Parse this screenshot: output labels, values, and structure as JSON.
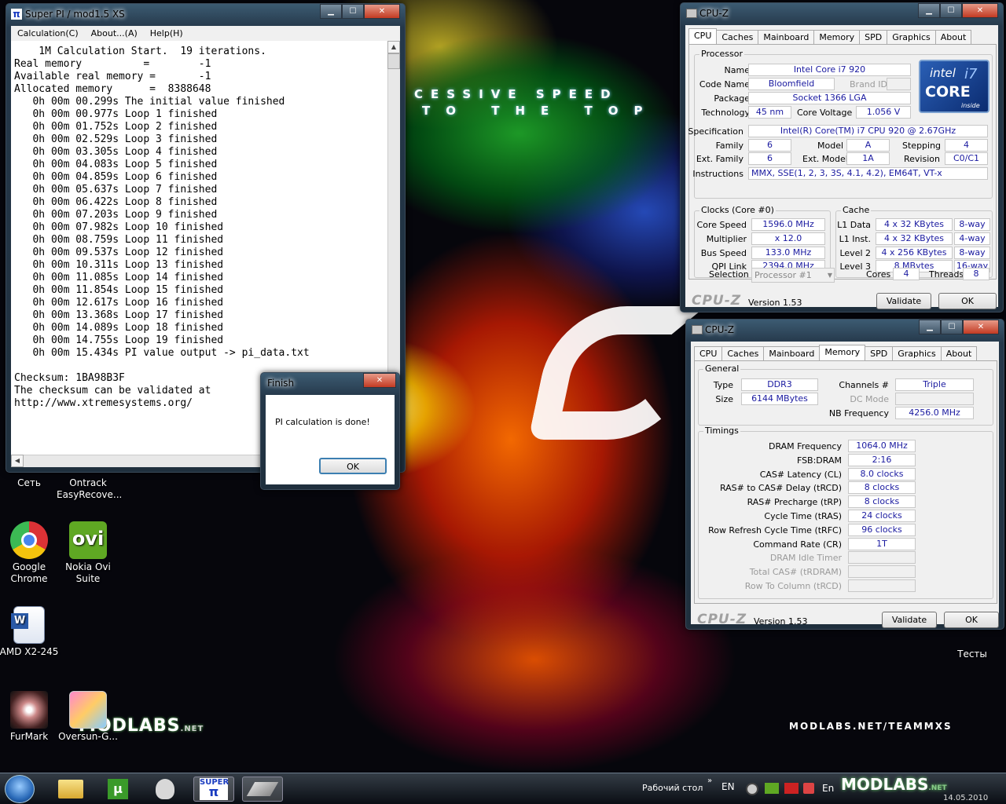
{
  "superpi": {
    "title": "Super PI / mod1.5 XS",
    "menu": [
      "Calculation(C)",
      "About...(A)",
      "Help(H)"
    ],
    "lines": [
      "    1M Calculation Start.  19 iterations.",
      "Real memory          =        -1",
      "Available real memory =       -1",
      "Allocated memory      =  8388648",
      "   0h 00m 00.299s The initial value finished",
      "   0h 00m 00.977s Loop 1 finished",
      "   0h 00m 01.752s Loop 2 finished",
      "   0h 00m 02.529s Loop 3 finished",
      "   0h 00m 03.305s Loop 4 finished",
      "   0h 00m 04.083s Loop 5 finished",
      "   0h 00m 04.859s Loop 6 finished",
      "   0h 00m 05.637s Loop 7 finished",
      "   0h 00m 06.422s Loop 8 finished",
      "   0h 00m 07.203s Loop 9 finished",
      "   0h 00m 07.982s Loop 10 finished",
      "   0h 00m 08.759s Loop 11 finished",
      "   0h 00m 09.537s Loop 12 finished",
      "   0h 00m 10.311s Loop 13 finished",
      "   0h 00m 11.085s Loop 14 finished",
      "   0h 00m 11.854s Loop 15 finished",
      "   0h 00m 12.617s Loop 16 finished",
      "   0h 00m 13.368s Loop 17 finished",
      "   0h 00m 14.089s Loop 18 finished",
      "   0h 00m 14.755s Loop 19 finished",
      "   0h 00m 15.434s PI value output -> pi_data.txt",
      "",
      "Checksum: 1BA98B3F",
      "The checksum can be validated at",
      "http://www.xtremesystems.org/"
    ]
  },
  "finish": {
    "title": "Finish",
    "message": "PI calculation is done!",
    "ok": "OK"
  },
  "cpuz1": {
    "title": "CPU-Z",
    "tabs": [
      "CPU",
      "Caches",
      "Mainboard",
      "Memory",
      "SPD",
      "Graphics",
      "About"
    ],
    "processor_title": "Processor",
    "name_l": "Name",
    "name": "Intel Core i7 920",
    "codename_l": "Code Name",
    "codename": "Bloomfield",
    "brandid_l": "Brand ID",
    "package_l": "Package",
    "package": "Socket 1366 LGA",
    "technology_l": "Technology",
    "technology": "45 nm",
    "voltage_l": "Core Voltage",
    "voltage": "1.056 V",
    "spec_l": "Specification",
    "spec": "Intel(R) Core(TM) i7 CPU        920  @ 2.67GHz",
    "family_l": "Family",
    "family": "6",
    "model_l": "Model",
    "model": "A",
    "stepping_l": "Stepping",
    "stepping": "4",
    "extfamily_l": "Ext. Family",
    "extfamily": "6",
    "extmodel_l": "Ext. Model",
    "extmodel": "1A",
    "revision_l": "Revision",
    "revision": "C0/C1",
    "instr_l": "Instructions",
    "instr": "MMX, SSE(1, 2, 3, 3S, 4.1, 4.2), EM64T, VT-x",
    "clocks_title": "Clocks (Core #0)",
    "corespeed_l": "Core Speed",
    "corespeed": "1596.0 MHz",
    "multiplier_l": "Multiplier",
    "multiplier": "x 12.0",
    "busspeed_l": "Bus Speed",
    "busspeed": "133.0 MHz",
    "qpi_l": "QPI Link",
    "qpi": "2394.0 MHz",
    "cache_title": "Cache",
    "l1d_l": "L1 Data",
    "l1d": "4 x 32 KBytes",
    "l1d_w": "8-way",
    "l1i_l": "L1 Inst.",
    "l1i": "4 x 32 KBytes",
    "l1i_w": "4-way",
    "l2_l": "Level 2",
    "l2": "4 x 256 KBytes",
    "l2_w": "8-way",
    "l3_l": "Level 3",
    "l3": "8 MBytes",
    "l3_w": "16-way",
    "selection_l": "Selection",
    "selection": "Processor #1",
    "cores_l": "Cores",
    "cores": "4",
    "threads_l": "Threads",
    "threads": "8",
    "brand": "CPU-Z",
    "version": "Version 1.53",
    "validate": "Validate",
    "ok": "OK",
    "logo": {
      "top": "intel",
      "mid": "CORE",
      "i7": "i7",
      "bottom": "inside"
    }
  },
  "cpuz2": {
    "title": "CPU-Z",
    "tabs": [
      "CPU",
      "Caches",
      "Mainboard",
      "Memory",
      "SPD",
      "Graphics",
      "About"
    ],
    "general_title": "General",
    "type_l": "Type",
    "type": "DDR3",
    "size_l": "Size",
    "size": "6144 MBytes",
    "channels_l": "Channels #",
    "channels": "Triple",
    "dcmode_l": "DC Mode",
    "nbfreq_l": "NB Frequency",
    "nbfreq": "4256.0 MHz",
    "timings_title": "Timings",
    "timings": [
      {
        "label": "DRAM Frequency",
        "value": "1064.0 MHz"
      },
      {
        "label": "FSB:DRAM",
        "value": "2:16"
      },
      {
        "label": "CAS# Latency (CL)",
        "value": "8.0 clocks"
      },
      {
        "label": "RAS# to CAS# Delay (tRCD)",
        "value": "8 clocks"
      },
      {
        "label": "RAS# Precharge (tRP)",
        "value": "8 clocks"
      },
      {
        "label": "Cycle Time (tRAS)",
        "value": "24 clocks"
      },
      {
        "label": "Row Refresh Cycle Time (tRFC)",
        "value": "96 clocks"
      },
      {
        "label": "Command Rate (CR)",
        "value": "1T"
      },
      {
        "label": "DRAM Idle Timer",
        "value": ""
      },
      {
        "label": "Total CAS# (tRDRAM)",
        "value": ""
      },
      {
        "label": "Row To Column (tRCD)",
        "value": ""
      }
    ],
    "brand": "CPU-Z",
    "version": "Version 1.53",
    "validate": "Validate",
    "ok": "OK"
  },
  "desktop": {
    "icons": [
      {
        "name": "net",
        "label": "Сеть"
      },
      {
        "name": "ontrack",
        "label": "Ontrack EasyRecove..."
      },
      {
        "name": "chrome",
        "label": "Google Chrome"
      },
      {
        "name": "ovi",
        "label": "Nokia Ovi Suite",
        "glyph": "ovi"
      },
      {
        "name": "word",
        "label": "AMD X2-245"
      },
      {
        "name": "furmark",
        "label": "FurMark"
      },
      {
        "name": "oversun",
        "label": "Oversun-G..."
      },
      {
        "name": "tests",
        "label": "Тесты"
      }
    ],
    "wall": {
      "line1": "CESSIVE SPEED",
      "line2": "TO THE TOP",
      "url": "MODLABS.NET/TEAMMXS",
      "logo": "MODLABS",
      "net": ".NET"
    }
  },
  "taskbar": {
    "desktop_label": "Рабочий стол",
    "lang": "EN",
    "lang2": "En",
    "clock": "14.05.2010",
    "super": "SUPER"
  },
  "colors": {
    "value_text": "#1a1aa0",
    "accent": "#2a8a2a"
  }
}
